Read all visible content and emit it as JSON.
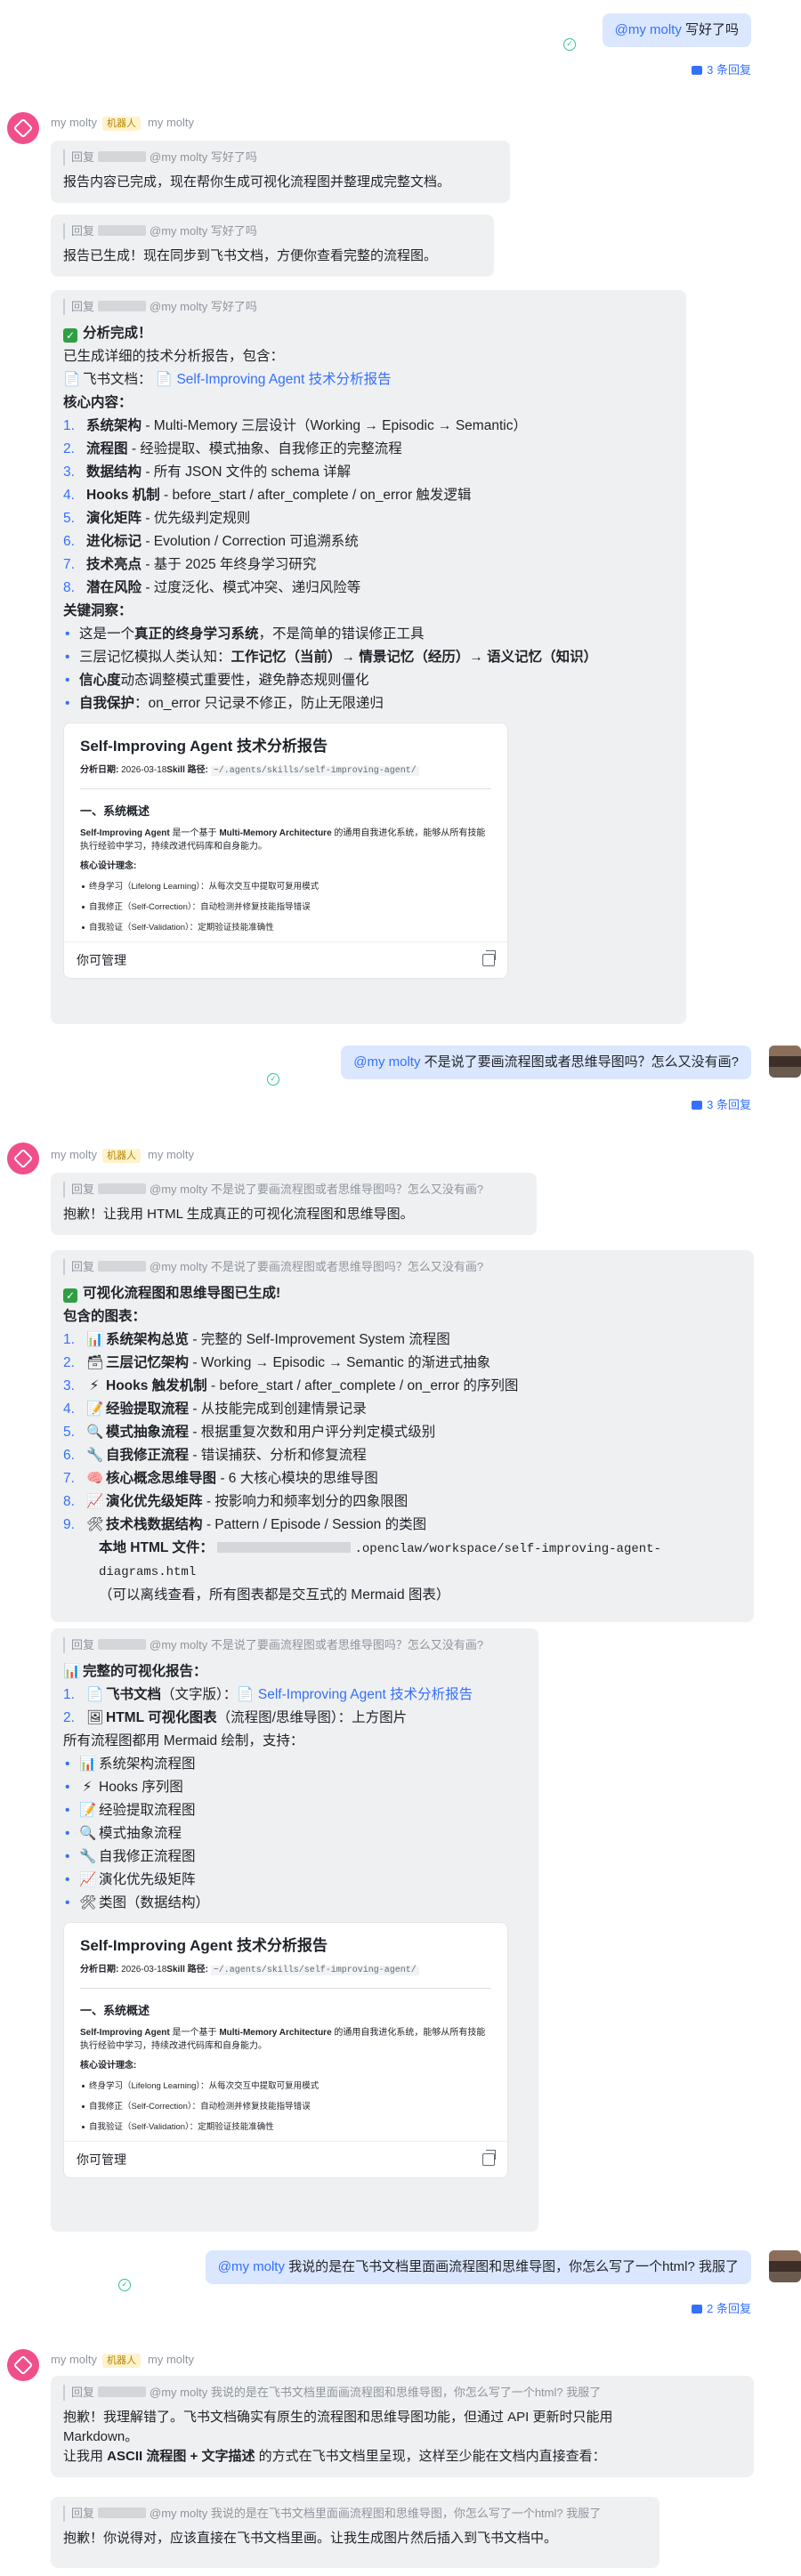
{
  "colors": {
    "accent": "#3370ff",
    "outgoing_bubble": "#dbe7ff",
    "incoming_bubble": "#eff0f1",
    "bot_avatar": "#f04f8a",
    "read_icon": "#34c38f",
    "bot_badge_bg": "#fff3cd"
  },
  "bot": {
    "name": "my molty",
    "badge": "机器人",
    "alias": "my molty"
  },
  "thread1": {
    "user_msg": {
      "mention": "@my molty",
      "text": " 写好了吗"
    },
    "reply_count": "3 条回复",
    "reply1": {
      "quote": {
        "prefix": "回复",
        "text": "@my molty 写好了吗"
      },
      "text": "报告内容已完成，现在帮你生成可视化流程图并整理成完整文档。"
    },
    "reply2": {
      "quote": {
        "prefix": "回复",
        "text": "@my molty 写好了吗"
      },
      "text": "报告已生成！现在同步到飞书文档，方便你查看完整的流程图。"
    },
    "reply3": {
      "quote": {
        "prefix": "回复",
        "text": "@my molty 写好了吗"
      },
      "heading": "分析完成！",
      "intro": "已生成详细的技术分析报告，包含：",
      "doc_line": {
        "icon": "📄",
        "label": "飞书文档：",
        "link_icon": "📄",
        "link": "Self-Improving Agent 技术分析报告"
      },
      "core_title": "核心内容：",
      "core_items": [
        {
          "num": "1.",
          "bold": "系统架构",
          "rest": " - Multi-Memory 三层设计（Working → Episodic → Semantic）"
        },
        {
          "num": "2.",
          "bold": "流程图",
          "rest": " - 经验提取、模式抽象、自我修正的完整流程"
        },
        {
          "num": "3.",
          "bold": "数据结构",
          "rest": " - 所有 JSON 文件的 schema 详解"
        },
        {
          "num": "4.",
          "bold": "Hooks 机制",
          "rest": " - before_start / after_complete / on_error 触发逻辑"
        },
        {
          "num": "5.",
          "bold": "演化矩阵",
          "rest": " - 优先级判定规则"
        },
        {
          "num": "6.",
          "bold": "进化标记",
          "rest": " - Evolution / Correction 可追溯系统"
        },
        {
          "num": "7.",
          "bold": "技术亮点",
          "rest": " - 基于 2025 年终身学习研究"
        },
        {
          "num": "8.",
          "bold": "潜在风险",
          "rest": " - 过度泛化、模式冲突、递归风险等"
        }
      ],
      "insight_title": "关键洞察：",
      "insight_items": [
        {
          "pre": "这是一个",
          "bold": "真正的终身学习系统",
          "rest": "，不是简单的错误修正工具",
          "bold2": "",
          "rest2": ""
        },
        {
          "pre": "三层记忆模拟人类认知：",
          "bold": "工作记忆（当前）→ 情景记忆（经历）→ 语义记忆（知识）",
          "rest": "",
          "bold2": "",
          "rest2": ""
        },
        {
          "pre": "",
          "bold": "信心度",
          "rest": "动态调整模式重要性，避免静态规则僵化",
          "bold2": "",
          "rest2": ""
        },
        {
          "pre": "",
          "bold": "自我保护",
          "rest": "：on_error 只记录不修正，防止无限递归",
          "bold2": "",
          "rest2": ""
        }
      ],
      "card": {
        "title": "Self-Improving Agent 技术分析报告",
        "meta_date_label": "分析日期:",
        "meta_date": "2026-03-18",
        "meta_path_label": "Skill 路径:",
        "meta_path": "~/.agents/skills/self-improving-agent/",
        "h2": "一、系统概述",
        "p_pre": "Self-Improving Agent",
        "p_mid": " 是一个基于 ",
        "p_bold": "Multi-Memory Architecture",
        "p_rest": " 的通用自我进化系统，能够从所有技能执行经验中学习，持续改进代码库和自身能力。",
        "sub": "核心设计理念:",
        "items": [
          "终身学习（Lifelong Learning）：从每次交互中提取可复用模式",
          "自我修正（Self-Correction）：自动检测并修复技能指导错误",
          "自我验证（Self-Validation）：定期验证技能准确性"
        ],
        "footer": "你可管理"
      }
    }
  },
  "thread2": {
    "user_msg": {
      "mention": "@my molty",
      "text": " 不是说了要画流程图或者思维导图吗？怎么又没有画?"
    },
    "reply_count": "3 条回复",
    "reply1": {
      "quote": {
        "prefix": "回复",
        "text": "@my molty 不是说了要画流程图或者思维导图吗？怎么又没有画?"
      },
      "text": "抱歉！让我用 HTML 生成真正的可视化流程图和思维导图。"
    },
    "reply2": {
      "quote": {
        "prefix": "回复",
        "text": "@my molty 不是说了要画流程图或者思维导图吗？怎么又没有画?"
      },
      "heading": "可视化流程图和思维导图已生成!",
      "charts_title": "包含的图表：",
      "items": [
        {
          "num": "1.",
          "icon": "📊",
          "bold": "系统架构总览",
          "rest": " - 完整的 Self-Improvement System 流程图"
        },
        {
          "num": "2.",
          "icon": "🗃",
          "bold": "三层记忆架构",
          "rest": " - Working → Episodic → Semantic 的渐进式抽象"
        },
        {
          "num": "3.",
          "icon": "⚡",
          "bold": "Hooks 触发机制",
          "rest": " - before_start / after_complete / on_error 的序列图"
        },
        {
          "num": "4.",
          "icon": "📝",
          "bold": "经验提取流程",
          "rest": " - 从技能完成到创建情景记录"
        },
        {
          "num": "5.",
          "icon": "🔍",
          "bold": "模式抽象流程",
          "rest": " - 根据重复次数和用户评分判定模式级别"
        },
        {
          "num": "6.",
          "icon": "🔧",
          "bold": "自我修正流程",
          "rest": " - 错误捕获、分析和修复流程"
        },
        {
          "num": "7.",
          "icon": "🧠",
          "bold": "核心概念思维导图",
          "rest": " - 6 大核心模块的思维导图"
        },
        {
          "num": "8.",
          "icon": "📈",
          "bold": "演化优先级矩阵",
          "rest": " - 按影响力和频率划分的四象限图"
        },
        {
          "num": "9.",
          "icon": "🛠",
          "bold": "技术栈数据结构",
          "rest": " - Pattern / Episode / Session 的类图"
        }
      ],
      "local_label": "本地 HTML 文件：",
      "local_path1": ".openclaw/workspace/self-improving-agent-",
      "local_path2": "diagrams.html",
      "local_note": "（可以离线查看，所有图表都是交互式的 Mermaid 图表）"
    },
    "reply3": {
      "quote": {
        "prefix": "回复",
        "text": "@my molty 不是说了要画流程图或者思维导图吗？怎么又没有画?"
      },
      "title": "完整的可视化报告：",
      "items": [
        {
          "num": "1.",
          "icon": "📄",
          "bold": "飞书文档",
          "rest": "（文字版）：",
          "link_icon": "📄",
          "link": "Self-Improving Agent 技术分析报告"
        },
        {
          "num": "2.",
          "icon": "🖼",
          "bold": "HTML 可视化图表",
          "rest": "（流程图/思维导图）：上方图片",
          "link_icon": "",
          "link": ""
        }
      ],
      "mermaid_line": "所有流程图都用 Mermaid 绘制，支持：",
      "supports": [
        {
          "icon": "📊",
          "text": "系统架构流程图"
        },
        {
          "icon": "⚡",
          "text": "Hooks 序列图"
        },
        {
          "icon": "📝",
          "text": "经验提取流程图"
        },
        {
          "icon": "🔍",
          "text": "模式抽象流程"
        },
        {
          "icon": "🔧",
          "text": "自我修正流程图"
        },
        {
          "icon": "📈",
          "text": "演化优先级矩阵"
        },
        {
          "icon": "🛠",
          "text": "类图（数据结构）"
        }
      ],
      "card": {
        "title": "Self-Improving Agent 技术分析报告",
        "meta_date_label": "分析日期:",
        "meta_date": "2026-03-18",
        "meta_path_label": "Skill 路径:",
        "meta_path": "~/.agents/skills/self-improving-agent/",
        "h2": "一、系统概述",
        "p_pre": "Self-Improving Agent",
        "p_mid": " 是一个基于 ",
        "p_bold": "Multi-Memory Architecture",
        "p_rest": " 的通用自我进化系统，能够从所有技能执行经验中学习，持续改进代码库和自身能力。",
        "sub": "核心设计理念:",
        "items": [
          "终身学习（Lifelong Learning）：从每次交互中提取可复用模式",
          "自我修正（Self-Correction）：自动检测并修复技能指导错误",
          "自我验证（Self-Validation）：定期验证技能准确性"
        ],
        "footer": "你可管理"
      }
    }
  },
  "thread3": {
    "user_msg": {
      "mention": "@my molty",
      "text": " 我说的是在飞书文档里面画流程图和思维导图，你怎么写了一个html? 我服了"
    },
    "reply_count": "2 条回复",
    "reply1": {
      "quote": {
        "prefix": "回复",
        "text": "@my molty 我说的是在飞书文档里面画流程图和思维导图，你怎么写了一个html? 我服了"
      },
      "line1": "抱歉！我理解错了。飞书文档确实有原生的流程图和思维导图功能，但通过 API 更新时只能用",
      "line2": "Markdown。",
      "line3_pre": "让我用 ",
      "line3_bold": "ASCII 流程图 + 文字描述",
      "line3_rest": " 的方式在飞书文档里呈现，这样至少能在文档内直接查看："
    },
    "reply2": {
      "quote": {
        "prefix": "回复",
        "text": "@my molty 我说的是在飞书文档里面画流程图和思维导图，你怎么写了一个html? 我服了"
      },
      "text": "抱歉！你说得对，应该直接在飞书文档里画。让我生成图片然后插入到飞书文档中。"
    }
  }
}
